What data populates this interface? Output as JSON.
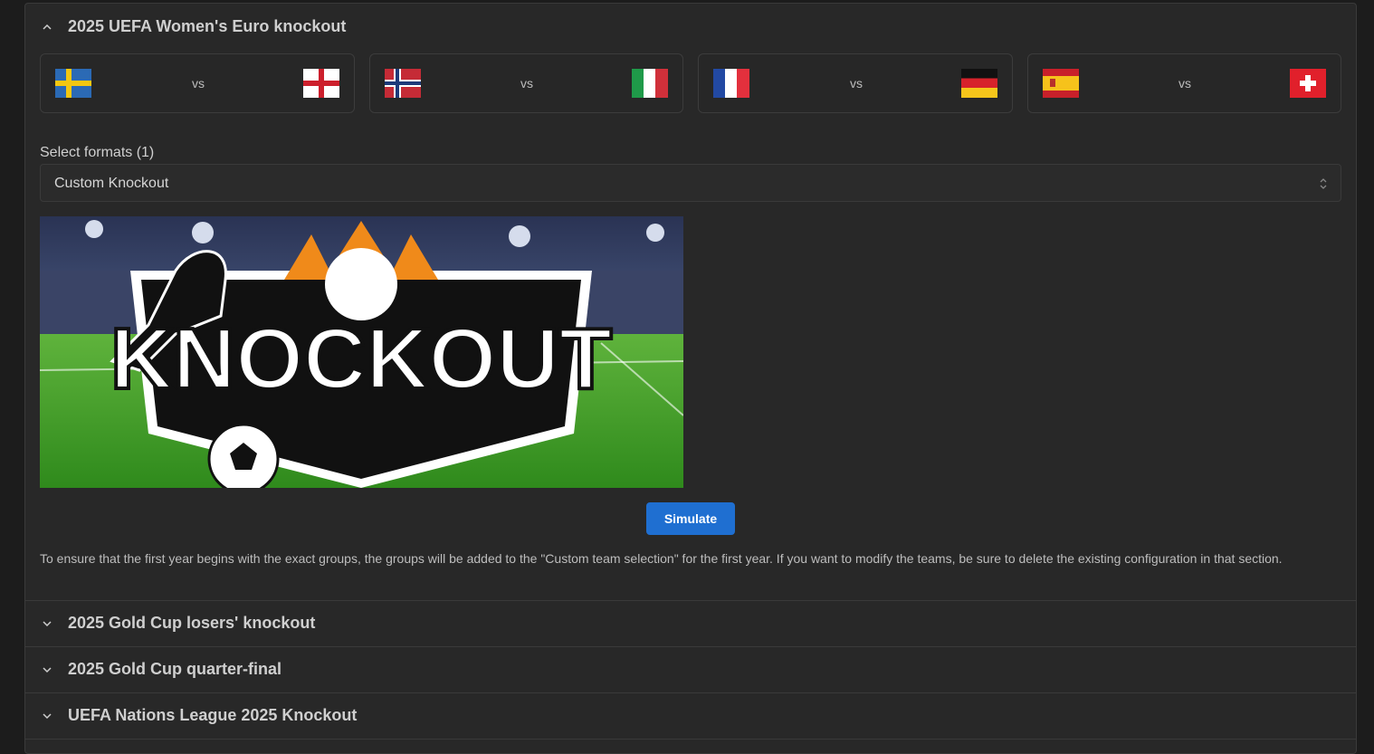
{
  "sections": [
    {
      "title": "2025 UEFA Women's Euro knockout",
      "expanded": true,
      "chevron": "chevron-up-icon"
    },
    {
      "title": "2025 Gold Cup losers' knockout",
      "expanded": false,
      "chevron": "chevron-down-icon"
    },
    {
      "title": "2025 Gold Cup quarter-final",
      "expanded": false,
      "chevron": "chevron-down-icon"
    },
    {
      "title": "UEFA Nations League 2025 Knockout",
      "expanded": false,
      "chevron": "chevron-down-icon"
    }
  ],
  "matches": [
    {
      "home": "sweden-flag-icon",
      "away": "england-flag-icon",
      "vs": "vs"
    },
    {
      "home": "norway-flag-icon",
      "away": "italy-flag-icon",
      "vs": "vs"
    },
    {
      "home": "france-flag-icon",
      "away": "germany-flag-icon",
      "vs": "vs"
    },
    {
      "home": "spain-flag-icon",
      "away": "switzerland-flag-icon",
      "vs": "vs"
    }
  ],
  "formats": {
    "label": "Select formats (1)",
    "selected": "Custom Knockout"
  },
  "banner": {
    "text": "KNOCKOUT"
  },
  "simulate_label": "Simulate",
  "note": "To ensure that the first year begins with the exact groups, the groups will be added to the \"Custom team selection\" for the first year. If you want to modify the teams, be sure to delete the existing configuration in that section.",
  "colors": {
    "accent": "#1f6fd1",
    "background": "#1c1c1c",
    "panel": "#282828"
  }
}
